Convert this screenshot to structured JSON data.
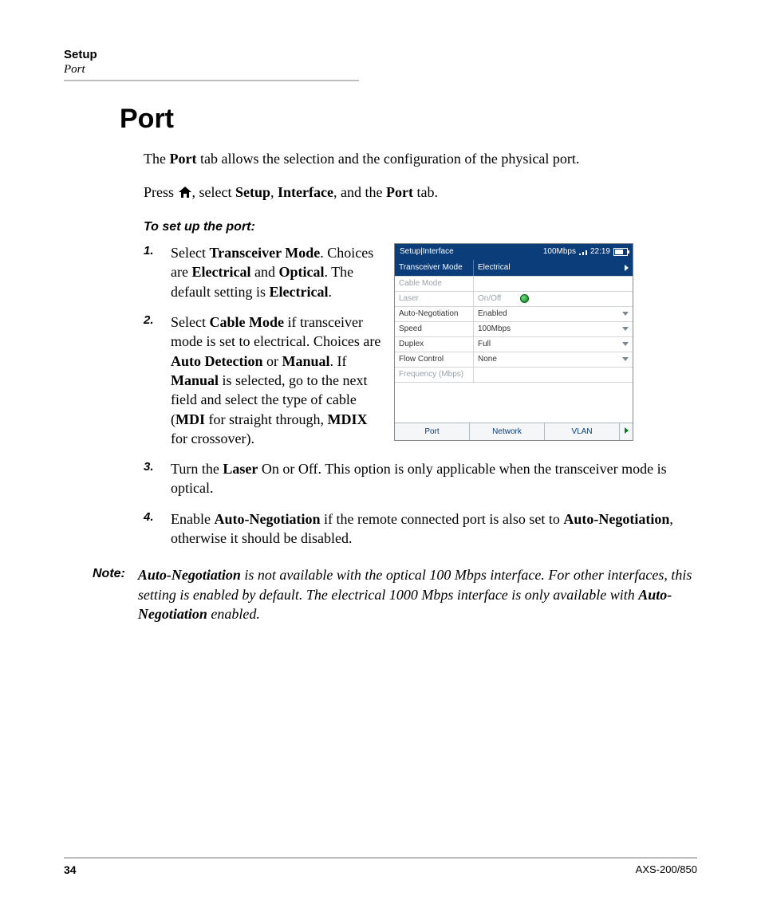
{
  "header": {
    "chapter": "Setup",
    "section": "Port"
  },
  "heading": "Port",
  "intro_pre": "The ",
  "intro_bold": "Port",
  "intro_post": " tab allows the selection and the configuration of the physical port.",
  "press": {
    "pre": "Press ",
    "mid1": ", select ",
    "b1": "Setup",
    "sep1": ", ",
    "b2": "Interface",
    "mid2": ", and the ",
    "b3": "Port",
    "post": " tab."
  },
  "subhead": "To set up the port:",
  "steps": {
    "s1": {
      "num": "1.",
      "t0": "Select ",
      "b0": "Transceiver Mode",
      "t1": ". Choices are ",
      "b1": "Electrical",
      "t2": " and ",
      "b2": "Optical",
      "t3": ". The default setting is ",
      "b3": "Electrical",
      "t4": "."
    },
    "s2": {
      "num": "2.",
      "t0": "Select ",
      "b0": "Cable Mode",
      "t1": " if transceiver mode is set to electrical. Choices are ",
      "b1": "Auto Detection",
      "t2": " or ",
      "b2": "Manual",
      "t3": ". If ",
      "b3": "Manual",
      "t4": " is selected, go to the next field and select the type of cable (",
      "b4": "MDI",
      "t5": " for straight through, ",
      "b5": "MDIX",
      "t6": " for crossover)."
    },
    "s3": {
      "num": "3.",
      "t0": "Turn the ",
      "b0": "Laser",
      "t1": " On or Off. This option is only applicable when the transceiver mode is optical."
    },
    "s4": {
      "num": "4.",
      "t0": "Enable ",
      "b0": "Auto-Negotiation",
      "t1": " if the remote connected port is also set to ",
      "b1": "Auto-Negotiation",
      "t2": ", otherwise it should be disabled."
    }
  },
  "note": {
    "label": "Note:",
    "b0": "Auto-Negotiation",
    "t0": " is not available with the optical 100  Mbps interface. For other interfaces, this setting is enabled by default. The electrical 1000 Mbps interface is only available with ",
    "b1": "Auto-Negotiation",
    "t1": " enabled."
  },
  "shot": {
    "title": "Setup|Interface",
    "status_speed": "100Mbps",
    "status_time": "22:19",
    "rows": {
      "transceiver": {
        "label": "Transceiver Mode",
        "value": "Electrical"
      },
      "cable": {
        "label": "Cable Mode",
        "value": ""
      },
      "laser": {
        "label": "Laser",
        "value": "On/Off"
      },
      "autoneg": {
        "label": "Auto-Negotiation",
        "value": "Enabled"
      },
      "speed": {
        "label": "Speed",
        "value": "100Mbps"
      },
      "duplex": {
        "label": "Duplex",
        "value": "Full"
      },
      "flow": {
        "label": "Flow Control",
        "value": "None"
      },
      "freq": {
        "label": "Frequency (Mbps)",
        "value": ""
      }
    },
    "tabs": {
      "port": "Port",
      "network": "Network",
      "vlan": "VLAN"
    }
  },
  "footer": {
    "page": "34",
    "model": "AXS-200/850"
  }
}
